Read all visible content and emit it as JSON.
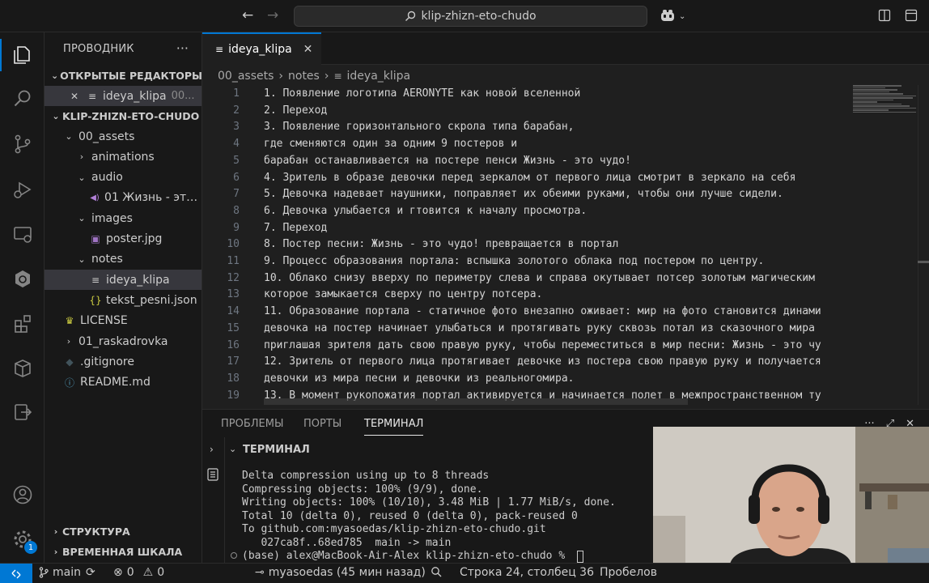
{
  "titlebar": {
    "search_text": "klip-zhizn-eto-chudo"
  },
  "sidebar": {
    "title": "ПРОВОДНИК",
    "more": "···",
    "open_editors": {
      "label": "ОТКРЫТЫЕ РЕДАКТОРЫ",
      "items": [
        {
          "name": "ideya_klipa",
          "path": "00..."
        }
      ]
    },
    "project": {
      "label": "KLIP-ZHIZN-ETO-CHUDO",
      "tree": [
        {
          "name": "00_assets",
          "kind": "folder-open",
          "depth": 1
        },
        {
          "name": "animations",
          "kind": "folder-closed",
          "depth": 2
        },
        {
          "name": "audio",
          "kind": "folder-open",
          "depth": 2
        },
        {
          "name": "01 Жизнь - это ч...",
          "kind": "audio",
          "depth": 3
        },
        {
          "name": "images",
          "kind": "folder-open",
          "depth": 2
        },
        {
          "name": "poster.jpg",
          "kind": "image",
          "depth": 3
        },
        {
          "name": "notes",
          "kind": "folder-open",
          "depth": 2
        },
        {
          "name": "ideya_klipa",
          "kind": "text",
          "depth": 3,
          "selected": true
        },
        {
          "name": "tekst_pesni.json",
          "kind": "json",
          "depth": 3
        },
        {
          "name": "LICENSE",
          "kind": "license",
          "depth": 1
        },
        {
          "name": "01_raskadrovka",
          "kind": "folder-closed",
          "depth": 1
        },
        {
          "name": ".gitignore",
          "kind": "git",
          "depth": 1
        },
        {
          "name": "README.md",
          "kind": "md",
          "depth": 1
        }
      ]
    },
    "outline_label": "СТРУКТУРА",
    "timeline_label": "ВРЕМЕННАЯ ШКАЛА"
  },
  "editor": {
    "tab_label": "ideya_klipa",
    "breadcrumb": [
      "00_assets",
      "notes",
      "ideya_klipa"
    ],
    "lines": [
      {
        "n": "1",
        "text": "1. Появление логотипа AERONYTE как новой вселенной"
      },
      {
        "n": "2",
        "text": "2. Переход"
      },
      {
        "n": "3",
        "text": "3. Появление горизонтального скрола типа барабан,"
      },
      {
        "n": "4",
        "text": "где сменяются один за одним 9 постеров и"
      },
      {
        "n": "5",
        "text": "барабан останавливается на постере пенси Жизнь - это чудо!"
      },
      {
        "n": "6",
        "text": "4. Зритель в образе девочки перед зеркалом от первого лица смотрит в зеркало на себя"
      },
      {
        "n": "7",
        "text": "5. Девочка надевает наушники, поправляет их обеими руками, чтобы они лучше сидели."
      },
      {
        "n": "8",
        "text": "6. Девочка улыбается и гтовится к началу просмотра."
      },
      {
        "n": "9",
        "text": "7. Переход"
      },
      {
        "n": "10",
        "text": "8. Постер песни: Жизнь - это чудо! превращается в портал"
      },
      {
        "n": "11",
        "text": "9. Процесс образования портала: вспышка золотого облака под постером по центру."
      },
      {
        "n": "12",
        "text": "10. Облако снизу вверху по периметру слева и справа окутывает потсер золотым магическим"
      },
      {
        "n": "13",
        "text": "которое замыкается сверху по центру потсера."
      },
      {
        "n": "14",
        "text": "11. Образование портала - статичное фото внезапно оживает: мир на фото становится динами"
      },
      {
        "n": "15",
        "text": "девочка на постер начинает улыбаться и протягивать руку сквозь потал из сказочного мира"
      },
      {
        "n": "16",
        "text": "приглашая зрителя дать свою правую руку, чтобы переместиться в мир песни: Жизнь - это чу"
      },
      {
        "n": "17",
        "text": "12. Зритель от первого лица протягивает девочке из постера свою правую руку и получается"
      },
      {
        "n": "18",
        "text": "девочки из мира песни и девочки из реальногомира."
      },
      {
        "n": "19",
        "text": "13. В момент рукопожатия портал активируется и начинается полет в межпространственном ту"
      }
    ]
  },
  "panel": {
    "tabs": [
      "ПРОБЛЕМЫ",
      "ПОРТЫ",
      "ТЕРМИНАЛ"
    ],
    "terminal_title": "ТЕРМИНАЛ",
    "terminal_lines": [
      "Delta compression using up to 8 threads",
      "Compressing objects: 100% (9/9), done.",
      "Writing objects: 100% (10/10), 3.48 MiB | 1.77 MiB/s, done.",
      "Total 10 (delta 0), reused 0 (delta 0), pack-reused 0",
      "To github.com:myasoedas/klip-zhizn-eto-chudo.git",
      "   027ca8f..68ed785  main -> main",
      "(base) alex@MacBook-Air-Alex klip-zhizn-eto-chudo % "
    ]
  },
  "statusbar": {
    "branch": "main",
    "errors": "0",
    "warnings": "0",
    "blame": "myasoedas (45 мин назад)",
    "position": "Строка 24, столбец 36",
    "indent": "Пробелов"
  },
  "notifications_count": "1",
  "colors": {
    "accent": "#0078d4",
    "bg": "#1f1f1f",
    "chrome": "#181818"
  }
}
